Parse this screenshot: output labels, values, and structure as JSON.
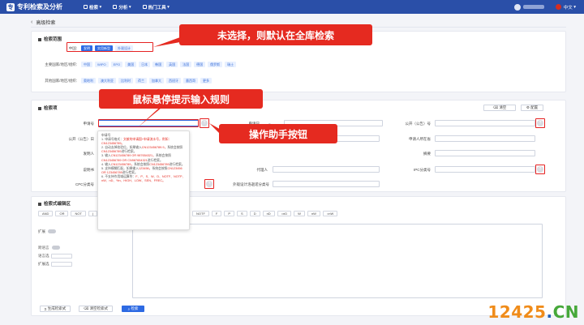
{
  "header": {
    "app_title": "专利检索及分析",
    "nav": [
      "检索",
      "分析",
      "热门工具"
    ],
    "lang": "中文"
  },
  "breadcrumb": {
    "back": "‹",
    "title": "高级检索"
  },
  "scope": {
    "title": "检索范围",
    "china_label": "中国:",
    "china_chips": [
      "发明",
      "实用新型",
      "外观设计"
    ],
    "major_label": "主要国家/地区/组织:",
    "major_chips": [
      "中国",
      "WIPO",
      "EPO",
      "美国",
      "日本",
      "韩国",
      "英国",
      "法国",
      "德国",
      "俄罗斯",
      "瑞士"
    ],
    "other_label": "其他国家/地区/组织:",
    "other_chips": [
      "奥地利",
      "澳大利亚",
      "比利时",
      "荷兰",
      "加拿大",
      "西班牙",
      "墨西哥",
      "更多"
    ]
  },
  "search": {
    "title": "检索项",
    "clear_btn": "清空",
    "config_btn": "配置",
    "fields": {
      "app_no": "申请号",
      "app_date": "申请日",
      "app_date_op": "=",
      "pub_no": "公开（公告）号",
      "pub_date": "公开（公告）日",
      "applicant": "申请（专利权）人",
      "applicant_addr": "申请人所在省",
      "inventor": "发明人",
      "abstract": "摘要",
      "desc": "说明书",
      "agent": "代理人",
      "ipc": "IPC分类号",
      "cpc": "CPC分类号",
      "design_cls": "外观设计洛迦诺分类号"
    }
  },
  "tooltip": {
    "title": "申请号",
    "lines": [
      {
        "t": "1. 申请号格式：",
        "r": "文献的申请国+申请流水号，例如：CN123456789。"
      },
      {
        "t": "2. 自动去掉校验位，如果输入",
        "r": "CN123456789.9，",
        "t2": "系统会按照",
        "r2": "CN123456789",
        "t3": "进行检索。"
      },
      {
        "t": "3. 输入",
        "r": "CN123456789 OR 987654321，",
        "t2": "系统会按照",
        "r2": "CN123456789 OR CN987654321",
        "t3": "进行检索。"
      },
      {
        "t": "4. 输入",
        "r": "CN123456789，",
        "t2": "系统会按照",
        "r2": "CN123456789",
        "t3": "进行检索。"
      },
      {
        "t": "5. 支持模糊匹配，如果输入",
        "r": "123456，",
        "t2": "系统会按照",
        "r2": "CN123456 OR 123456789",
        "t3": "进行检索。"
      },
      {
        "t": "6. 不支持作用域运算符：",
        "r": "F、P、S、W、D、NOTF、NOTP、nW、nD、%n、HIGH、LOW、SEN、FREC。"
      }
    ]
  },
  "editor": {
    "title": "检索式编辑区",
    "ops_left": [
      "AND",
      "OR",
      "NOT",
      "("
    ],
    "ops_right": [
      "NOTF",
      "F",
      "P",
      "S",
      "D",
      "nD",
      "=nD",
      "W",
      "nW",
      "=nW"
    ],
    "expand_label": "扩展",
    "lang_label": "跨语言",
    "source_label": "语言选",
    "expand2_label": "扩展选",
    "gen_btn": "生成检索式",
    "clear_btn": "清空检索式",
    "search_btn": "检索"
  },
  "annotations": {
    "a1": "未选择，则默认在全库检索",
    "a2": "鼠标悬停提示输入规则",
    "a3": "操作助手按钮"
  },
  "watermark": {
    "num": "12425",
    "dot": ".",
    "cn": "CN"
  },
  "colors": {
    "primary": "#2a4fa8",
    "accent": "#2d6ae3",
    "annotation": "#e52a20",
    "wm_orange": "#f08c1a",
    "wm_blue": "#1f5fb8",
    "wm_green": "#46a83a"
  }
}
